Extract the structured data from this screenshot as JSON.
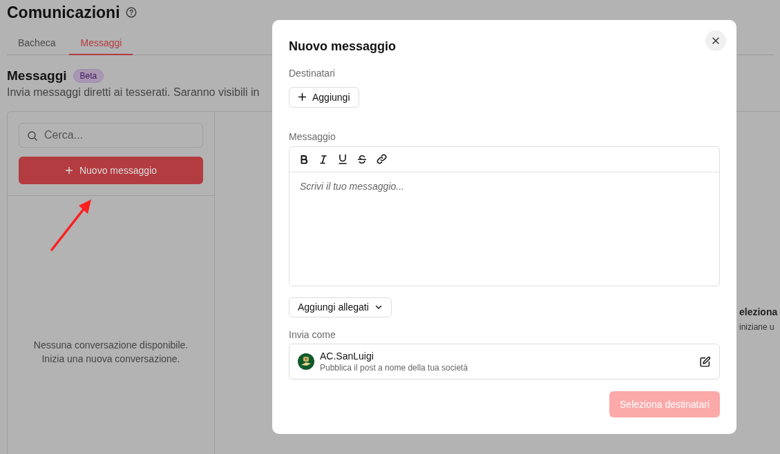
{
  "page": {
    "title": "Comunicazioni",
    "tabs": [
      {
        "label": "Bacheca",
        "selected": false
      },
      {
        "label": "Messaggi",
        "selected": true
      }
    ],
    "section": {
      "title": "Messaggi",
      "badge": "Beta",
      "description": "Invia messaggi diretti ai tesserati. Saranno visibili in"
    },
    "search": {
      "placeholder": "Cerca..."
    },
    "new_button": "Nuovo messaggio",
    "empty_list": [
      "Nessuna conversazione disponibile.",
      "Inizia una nuova conversazione."
    ],
    "detail_empty": {
      "title": "eleziona",
      "text": "iniziane u"
    }
  },
  "dialog": {
    "title": "Nuovo messaggio",
    "recipients_label": "Destinatari",
    "add_button": "Aggiungi",
    "message_label": "Messaggio",
    "message_placeholder": "Scrivi il tuo messaggio...",
    "attachments_button": "Aggiungi allegati",
    "send_as_label": "Invia come",
    "sender": {
      "name": "AC.SanLuigi",
      "subtitle": "Pubblica il post a nome della tua società"
    },
    "submit": {
      "label": "Seleziona destinatari",
      "disabled": true
    }
  }
}
